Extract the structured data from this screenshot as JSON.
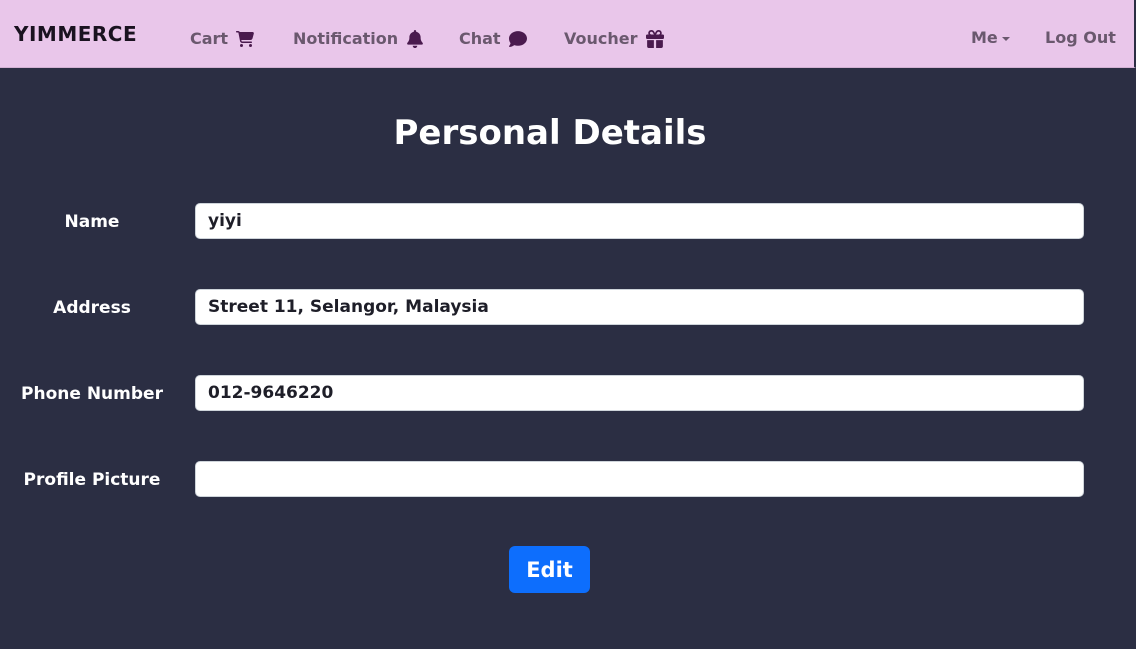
{
  "navbar": {
    "brand": "YIMMERCE",
    "links": [
      {
        "label": "Cart",
        "icon": "cart-icon"
      },
      {
        "label": "Notification",
        "icon": "bell-icon"
      },
      {
        "label": "Chat",
        "icon": "chat-bubble-icon"
      },
      {
        "label": "Voucher",
        "icon": "gift-icon"
      }
    ],
    "me": "Me",
    "logout": "Log Out"
  },
  "page": {
    "title": "Personal Details"
  },
  "form": {
    "name": {
      "label": "Name",
      "value": "yiyi"
    },
    "address": {
      "label": "Address",
      "value": "Street 11, Selangor, Malaysia"
    },
    "phone": {
      "label": "Phone Number",
      "value": "012-9646220"
    },
    "picture": {
      "label": "Profile Picture",
      "value": ""
    },
    "edit_label": "Edit"
  },
  "colors": {
    "navbar_bg": "#e9c6ea",
    "page_bg": "#2b2e43",
    "primary_button": "#0d6efd"
  }
}
